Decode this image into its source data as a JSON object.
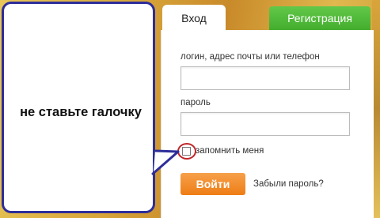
{
  "callout": {
    "text": "не ставьте галочку",
    "border_color": "#2d2d9a"
  },
  "tabs": {
    "login_label": "Вход",
    "register_label": "Регистрация",
    "register_color": "#44ad2e"
  },
  "form": {
    "login_label": "логин, адрес почты или телефон",
    "login_value": "",
    "password_label": "пароль",
    "password_value": "",
    "remember_label": "запомнить меня",
    "remember_checked": false,
    "highlight_color": "#c0262a",
    "submit_label": "Войти",
    "submit_color": "#ee7d15",
    "forgot_label": "Забыли пароль?"
  }
}
